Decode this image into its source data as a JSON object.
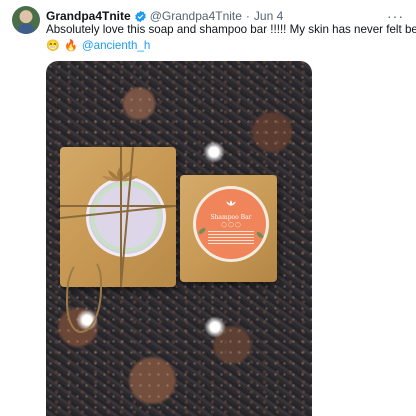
{
  "tweet": {
    "author": {
      "display_name": "Grandpa4Tnite",
      "handle": "@Grandpa4Tnite",
      "verified_icon": "verified-badge-icon"
    },
    "separator": "·",
    "date": "Jun 4",
    "more_label": "···",
    "text_line1": "Absolutely love this soap and shampoo bar !!!!! My skin has never felt better",
    "emojis": [
      "😁",
      "🔥"
    ],
    "mention": "@ancienth_h"
  },
  "media": {
    "right_bar_label": "Shampoo Bar",
    "colors": {
      "paper": "#c89a55",
      "label_orange": "#f0845a",
      "granite": "#2e2b2e",
      "link": "#1d9bf0"
    }
  }
}
